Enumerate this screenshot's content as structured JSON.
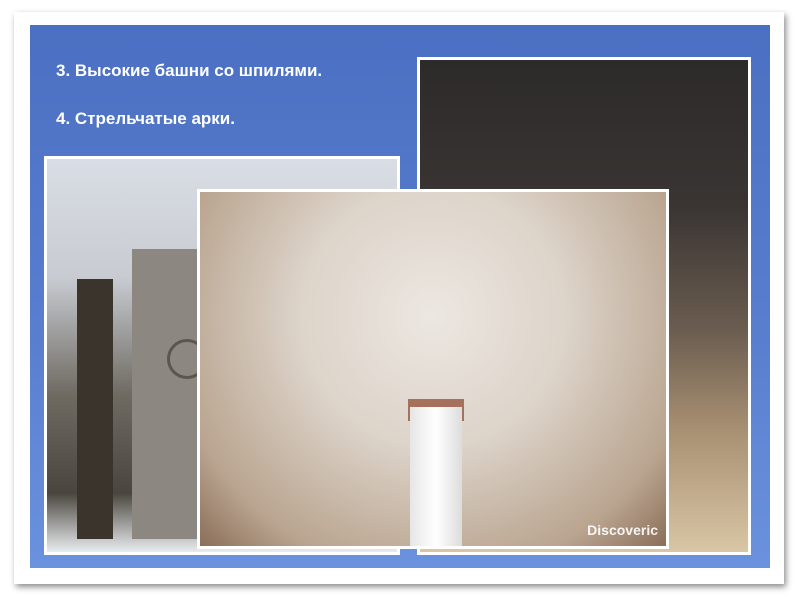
{
  "slide": {
    "lines": [
      "3. Высокие башни со шпилями.",
      "4. Стрельчатые арки."
    ],
    "watermark": "Discoveric"
  }
}
